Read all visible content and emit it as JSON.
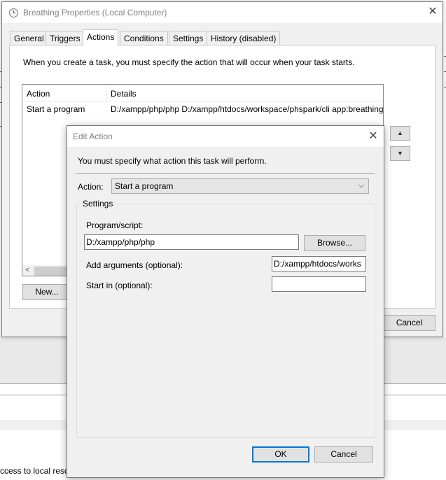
{
  "background": {
    "partial_text": "ccess to local reso"
  },
  "properties_window": {
    "title": "Breathing Properties (Local Computer)",
    "close_glyph": "✕",
    "tabs": [
      {
        "label": "General"
      },
      {
        "label": "Triggers"
      },
      {
        "label": "Actions"
      },
      {
        "label": "Conditions"
      },
      {
        "label": "Settings"
      },
      {
        "label": "History (disabled)"
      }
    ],
    "active_tab": "Actions",
    "intro_text": "When you create a task, you must specify the action that will occur when your task starts.",
    "action_list": {
      "columns": [
        "Action",
        "Details"
      ],
      "rows": [
        {
          "action": "Start a program",
          "details": "D:/xampp/php/php D:/xampp/htdocs/workspace/phspark/cli app:breathing"
        }
      ]
    },
    "scroll_left_glyph": "<",
    "move_up_glyph": "▲",
    "move_down_glyph": "▼",
    "new_button": "New...",
    "cancel_button": "Cancel"
  },
  "edit_action_dialog": {
    "title": "Edit Action",
    "close_glyph": "✕",
    "intro_text": "You must specify what action this task will perform.",
    "action_label": "Action:",
    "action_value": "Start a program",
    "dropdown_glyph": "⌵",
    "settings_legend": "Settings",
    "program_label": "Program/script:",
    "program_value": "D:/xampp/php/php",
    "browse_button": "Browse...",
    "arguments_label": "Add arguments (optional):",
    "arguments_value": "D:/xampp/htdocs/works",
    "start_in_label": "Start in (optional):",
    "start_in_value": "",
    "ok_button": "OK",
    "cancel_button": "Cancel"
  }
}
